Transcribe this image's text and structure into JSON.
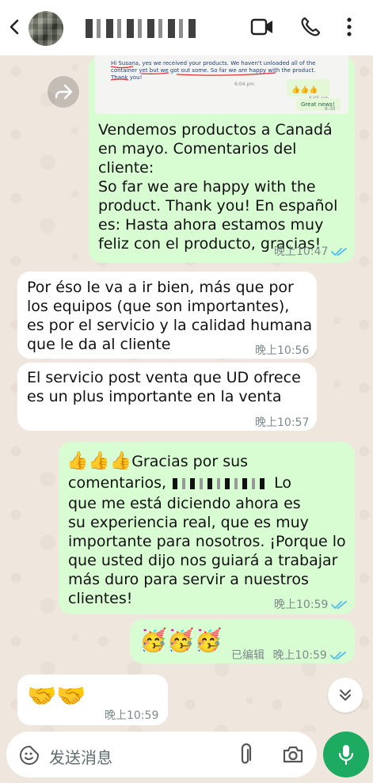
{
  "header": {
    "back_icon": "arrow-left-icon",
    "icons": [
      "video-call-icon",
      "voice-call-icon",
      "more-options-icon"
    ]
  },
  "messages": [
    {
      "id": "m1",
      "direction": "outgoing",
      "image_text": {
        "line1": "Hi Susana, yes we received your products. We haven't unloaded all of the",
        "line2": "container yet but we got out some. So far we are happy with the product.",
        "line3": "Thank you!",
        "stamp1": "6:04 pm",
        "stamp2": "6:05 pm",
        "stamp3": "6:30 pm",
        "reply": "Great news!"
      },
      "text": "Vendemos productos a Canadá\nen mayo. Comentarios del cliente:\nSo far we are happy with the\nproduct. Thank you! En español\nes: Hasta ahora estamos muy\nfeliz con el producto, gracias!",
      "time": "晚上10:47"
    },
    {
      "id": "m2",
      "direction": "incoming",
      "text": "Por éso le va a ir bien, más que por\nlos equipos (que son importantes),\nes por el servicio y la calidad humana\nque le da al cliente",
      "time": "晚上10:56"
    },
    {
      "id": "m3",
      "direction": "incoming",
      "text": "El servicio post venta que UD ofrece\nes un plus importante en la venta",
      "time": "晚上10:57"
    },
    {
      "id": "m4",
      "direction": "outgoing",
      "emoji": "👍👍👍",
      "text_a": "Gracias por sus",
      "text_b": "comentarios,",
      "text_c": "Lo",
      "text_rest": "que me está diciendo ahora es\nsu experiencia real, que es muy\nimportante para nosotros. ¡Porque lo\nque usted dijo nos guiará a trabajar\nmás duro para servir a nuestros\nclientes!",
      "time": "晚上10:59"
    },
    {
      "id": "m5",
      "direction": "outgoing",
      "emoji": "🥳🥳🥳",
      "edited": "已编辑",
      "time": "晚上10:59"
    },
    {
      "id": "m6",
      "direction": "incoming",
      "emoji": "🤝🤝",
      "time": "晚上10:59"
    }
  ],
  "composer": {
    "placeholder": "发送消息",
    "icons": [
      "emoji-sticker-icon",
      "attach-icon",
      "camera-icon",
      "microphone-icon"
    ]
  },
  "colors": {
    "outgoing_bubble": "#d9fdd3",
    "incoming_bubble": "#ffffff",
    "chat_background": "#efe7dd",
    "mic_button": "#1daa61",
    "read_ticks": "#53bdeb"
  }
}
